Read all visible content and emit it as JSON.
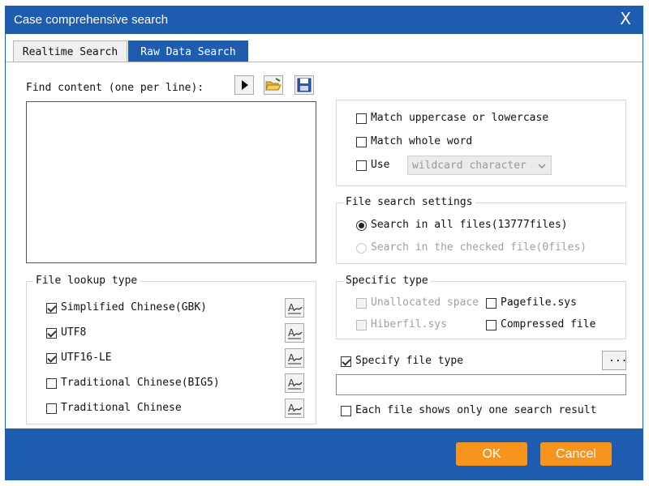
{
  "window": {
    "title": "Case comprehensive search",
    "close_glyph": "X"
  },
  "tabs": [
    {
      "label": "Realtime Search",
      "active": false
    },
    {
      "label": "Raw Data Search",
      "active": true
    }
  ],
  "find": {
    "label": "Find content (one per line):",
    "value": "",
    "icons": [
      "play-icon",
      "open-folder-icon",
      "save-disk-icon"
    ]
  },
  "match_options": {
    "uppercase_lowercase": {
      "label": "Match uppercase or lowercase",
      "checked": false
    },
    "whole_word": {
      "label": "Match whole word",
      "checked": false
    },
    "use": {
      "label": "Use",
      "checked": false,
      "select_value": "wildcard character"
    }
  },
  "file_search_settings": {
    "title": "File search settings",
    "all_files": {
      "label": "Search in all files(13777files)",
      "selected": true
    },
    "checked_file": {
      "label": "Search in the checked file(0files)",
      "selected": false,
      "disabled": true
    }
  },
  "file_lookup_type": {
    "title": "File lookup type",
    "items": [
      {
        "label": "Simplified Chinese(GBK)",
        "checked": true
      },
      {
        "label": "UTF8",
        "checked": true
      },
      {
        "label": "UTF16-LE",
        "checked": true
      },
      {
        "label": "Traditional Chinese(BIG5)",
        "checked": false
      },
      {
        "label": "Traditional Chinese",
        "checked": false
      }
    ]
  },
  "specific_type": {
    "title": "Specific type",
    "unallocated": {
      "label": "Unallocated space",
      "checked": false,
      "disabled": true
    },
    "pagefile": {
      "label": "Pagefile.sys",
      "checked": false
    },
    "hiberfil": {
      "label": "Hiberfil.sys",
      "checked": false,
      "disabled": true
    },
    "compressed": {
      "label": "Compressed file",
      "checked": false
    }
  },
  "specify_file_type": {
    "label": "Specify file type",
    "checked": true,
    "value": "",
    "browse_label": "..."
  },
  "one_result": {
    "label": "Each file shows only one search result",
    "checked": false
  },
  "footer": {
    "ok": "OK",
    "cancel": "Cancel"
  },
  "colors": {
    "title_bar": "#1e5cb0",
    "button": "#f7941d"
  }
}
